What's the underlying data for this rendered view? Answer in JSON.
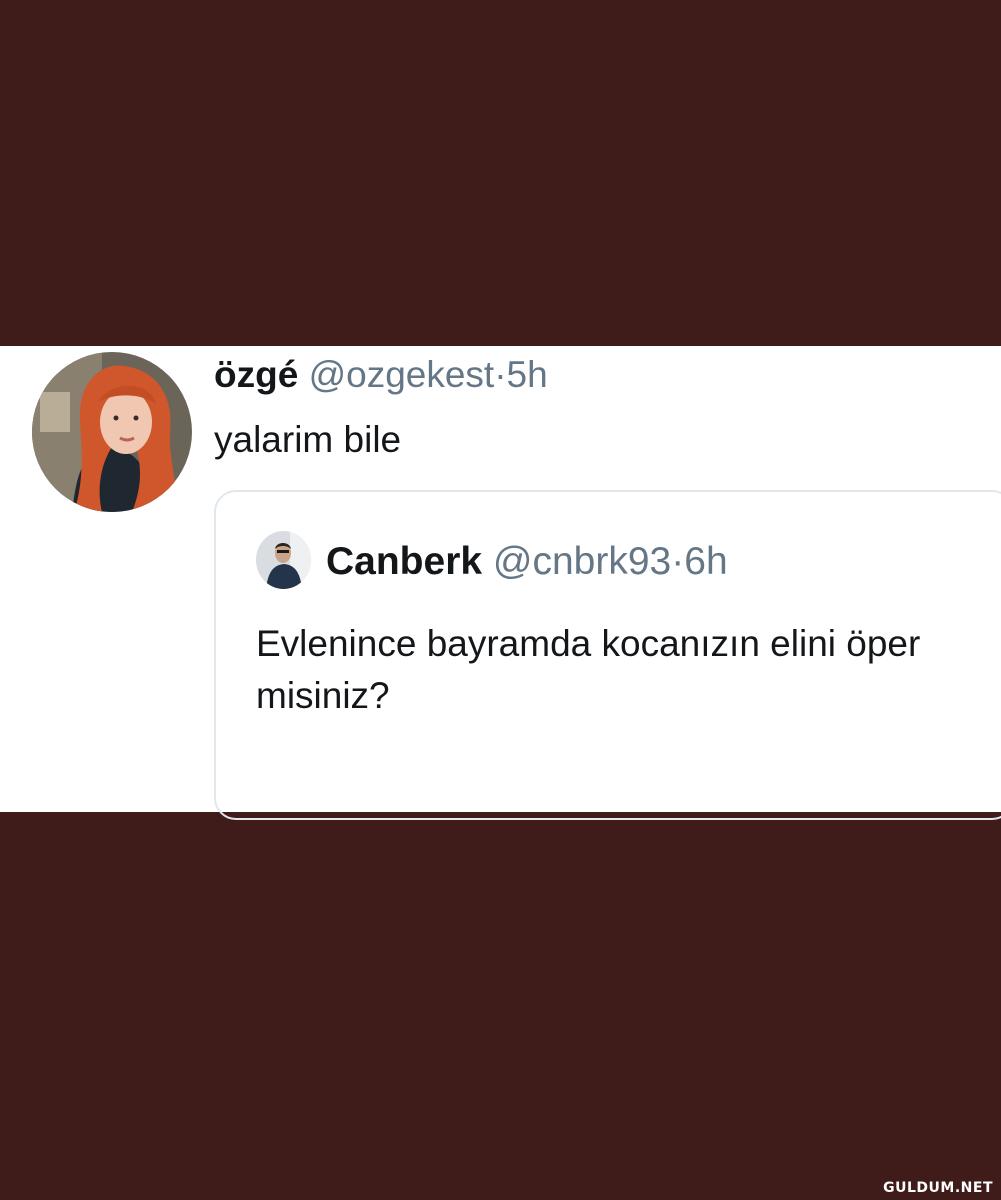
{
  "tweet": {
    "author": {
      "display_name": "özgé",
      "handle": "@ozgekest",
      "time": "5h",
      "separator": "·",
      "avatar_icon": "profile-photo-redhead"
    },
    "text": "yalarim bile",
    "quoted_tweet": {
      "author": {
        "display_name": "Canberk",
        "handle": "@cnbrk93",
        "time": "6h",
        "separator": "·",
        "avatar_icon": "profile-photo-man"
      },
      "text": "Evlenince bayramda kocanızın elini öper misiniz?"
    }
  },
  "watermark": "GULDUM.NET",
  "colors": {
    "background": "#3f1b1a",
    "card": "#ffffff",
    "text": "#14171a",
    "muted": "#657786",
    "border": "#e1e8ed"
  }
}
